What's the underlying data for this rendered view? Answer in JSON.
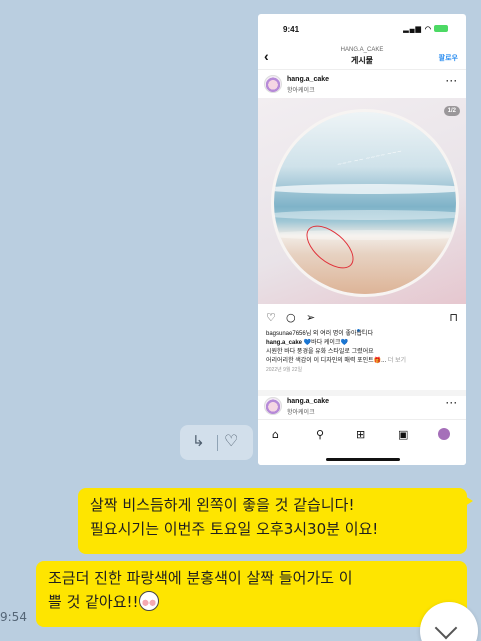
{
  "shared_image": {
    "status_time": "9:41",
    "header": {
      "account": "HANG.A_CAKE",
      "title": "게시물",
      "follow_label": "팔로우"
    },
    "post_user": {
      "name": "hang.a_cake",
      "subtitle": "항아케이크"
    },
    "photo_counter": "1/2",
    "caption": {
      "likes_text": "bagsunae7656님 외 여러 명이 좋아합니다",
      "author": "hang.a_cake",
      "line1_rest": "💙바다 케이크💙",
      "line2": "시원한 바다 풍경을 유화 스타일로 그렸어요",
      "line3": "어리어리한 색감이 이 디자인의 매력 포인트🎁...",
      "more": "더 보기",
      "date": "2022년 9월 22일"
    },
    "second_post_user": {
      "name": "hang.a_cake",
      "subtitle": "항아케이크"
    }
  },
  "messages": [
    {
      "line1": "살짝 비스듬하게 왼쪽이 좋을 것 같습니다!",
      "line2": "필요시기는 이번주 토요일 오후3시30분 이요!"
    },
    {
      "line1": "조금더 진한 파랑색에 분홍색이 살짝 들어가도 이",
      "line2": "쁠 것 같아요!!"
    }
  ],
  "message_time": "9:54"
}
